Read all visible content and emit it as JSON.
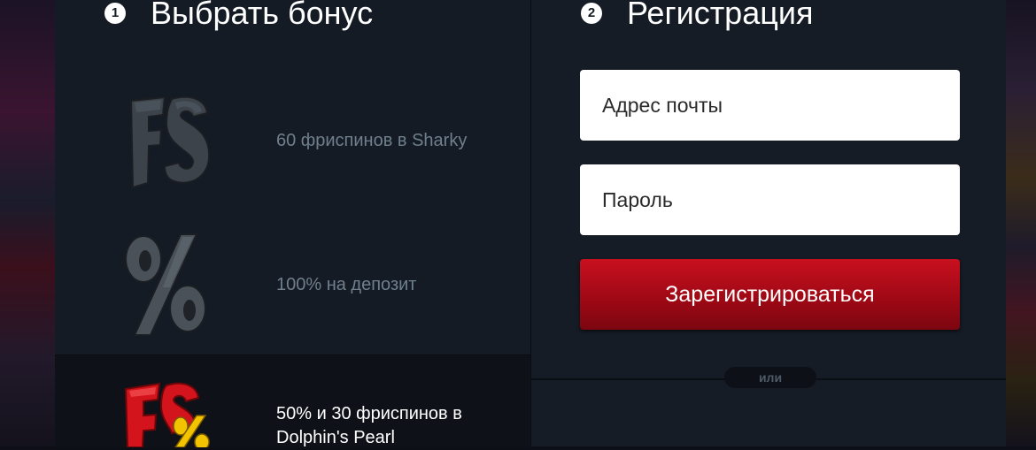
{
  "steps": {
    "bonus": {
      "number": "1",
      "title": "Выбрать бонус"
    },
    "registration": {
      "number": "2",
      "title": "Регистрация"
    }
  },
  "bonuses": [
    {
      "icon": "fs-freespins-icon",
      "label": "60 фриспинов в Sharky",
      "selected": false
    },
    {
      "icon": "percent-deposit-icon",
      "label": "100% на депозит",
      "selected": false
    },
    {
      "icon": "fs-percent-combo-icon",
      "label": "50% и 30 фриспинов в Dolphin's Pearl",
      "selected": true
    }
  ],
  "form": {
    "email_placeholder": "Адрес почты",
    "password_placeholder": "Пароль",
    "submit_label": "Зарегистрироваться",
    "or_label": "или"
  },
  "colors": {
    "accent_red": "#b30c19",
    "panel_bg": "#151b24",
    "muted_text": "#6f7f8d"
  }
}
